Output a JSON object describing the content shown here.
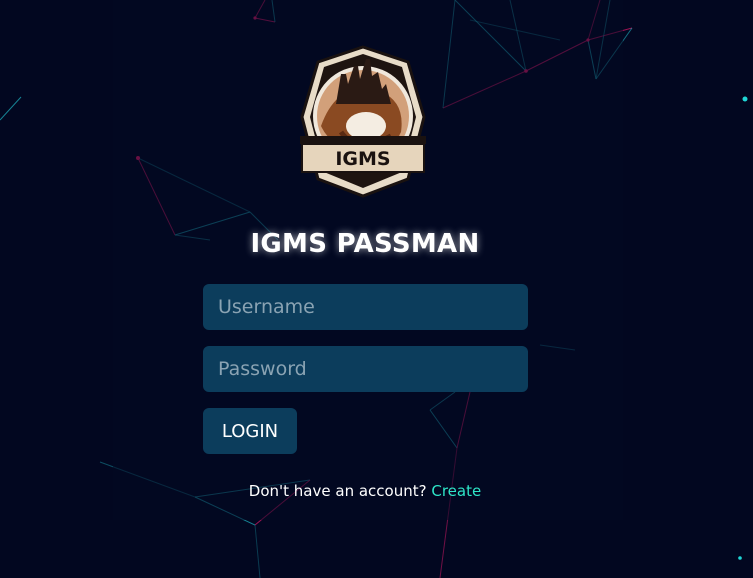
{
  "app": {
    "title": "IGMS PASSMAN",
    "logo_text": "IGMS"
  },
  "form": {
    "username_placeholder": "Username",
    "password_placeholder": "Password",
    "login_label": "LOGIN"
  },
  "signup": {
    "prompt": "Don't have an account?",
    "link_label": "Create"
  },
  "colors": {
    "background": "#020720",
    "field_bg": "#0c3d5c",
    "link": "#2ee6c8",
    "accent_pink": "#e01a6a",
    "accent_teal": "#1fb7c4"
  }
}
